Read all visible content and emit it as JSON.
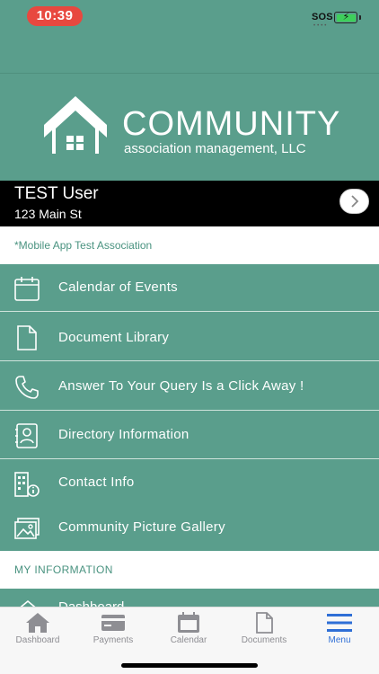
{
  "status": {
    "time": "10:39",
    "carrier": "SOS"
  },
  "brand": {
    "title": "COMMUNITY",
    "subtitle": "association management, LLC"
  },
  "user": {
    "name": "TEST User",
    "address": "123 Main St"
  },
  "association": "*Mobile App Test Association",
  "menu": [
    {
      "label": "Calendar of Events",
      "icon": "calendar-icon"
    },
    {
      "label": "Document Library",
      "icon": "document-icon"
    },
    {
      "label": "Answer To Your Query Is a Click Away !",
      "icon": "phone-icon"
    },
    {
      "label": "Directory Information",
      "icon": "directory-icon"
    },
    {
      "label": "Contact Info",
      "icon": "building-info-icon"
    },
    {
      "label": "Community Picture Gallery",
      "icon": "gallery-icon"
    }
  ],
  "section": {
    "my_information": "MY INFORMATION"
  },
  "peek_item": {
    "label": "Dashboard",
    "icon": "home-icon"
  },
  "tabs": [
    {
      "label": "Dashboard",
      "icon": "home-icon",
      "active": false
    },
    {
      "label": "Payments",
      "icon": "credit-card-icon",
      "active": false
    },
    {
      "label": "Calendar",
      "icon": "calendar-icon",
      "active": false
    },
    {
      "label": "Documents",
      "icon": "document-icon",
      "active": false
    },
    {
      "label": "Menu",
      "icon": "hamburger-menu-icon",
      "active": true
    }
  ],
  "colors": {
    "primary": "#5a9e8c",
    "accent_blue": "#2f6fd6",
    "time_pill": "#e8483f"
  }
}
